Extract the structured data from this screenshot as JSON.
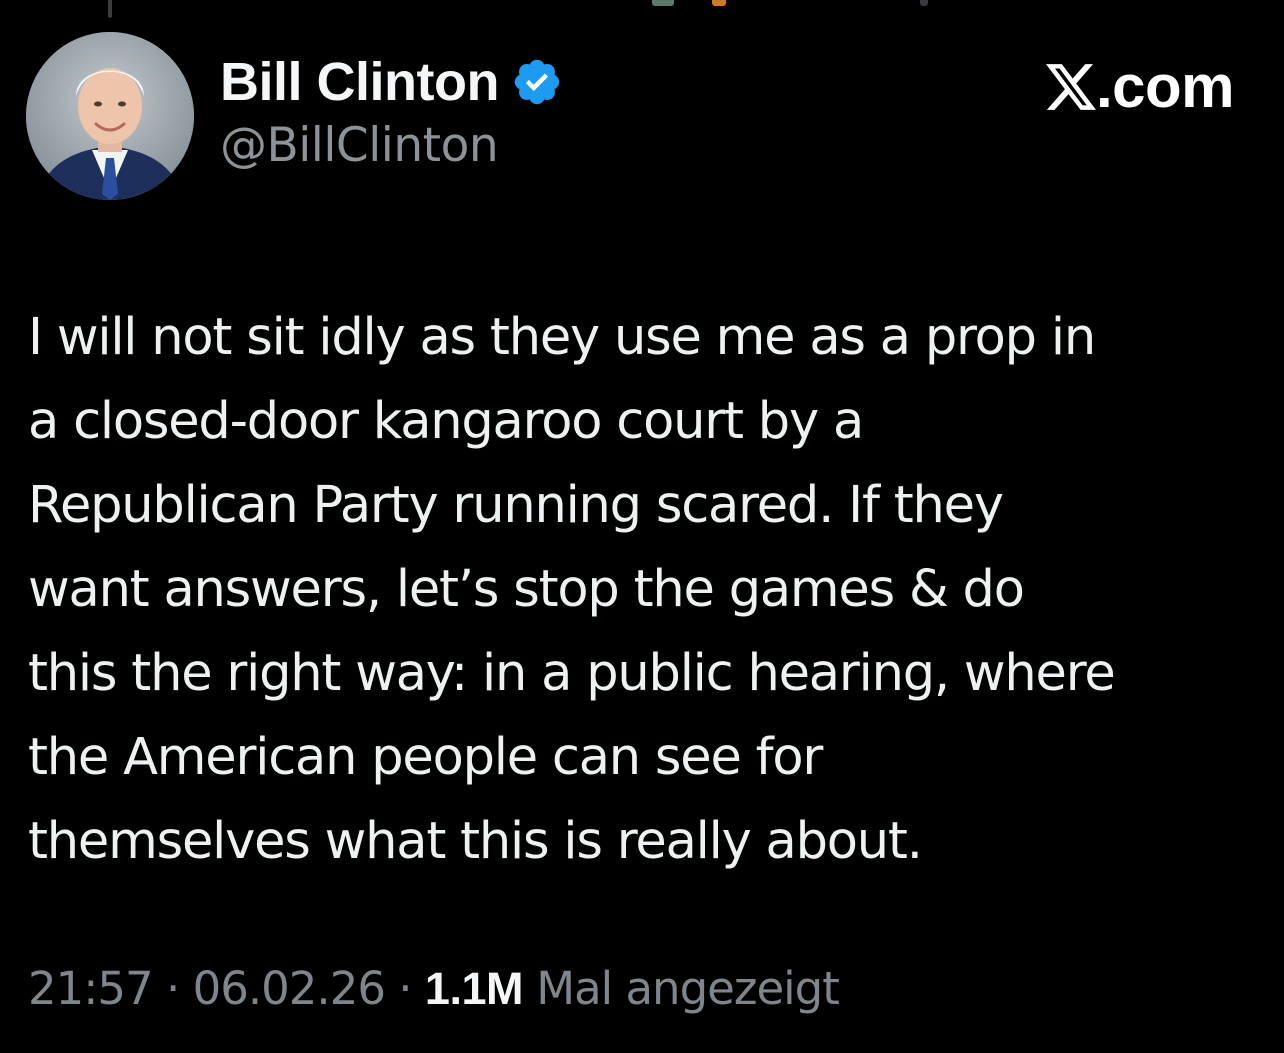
{
  "author": {
    "display_name": "Bill Clinton",
    "handle": "@BillClinton",
    "verified": true,
    "avatar_icon": "avatar-photo-icon"
  },
  "brand": {
    "label": "X.com",
    "logo_letter": "X",
    "suffix": ".com"
  },
  "tweet": {
    "lines": [
      "I will not sit idly as they use me as a prop in",
      "a closed-door kangaroo court by a",
      "Republican Party running scared. If they",
      "want answers, let’s stop the games & do",
      "this the right way: in a public hearing, where",
      "the American people can see for",
      "themselves what this is really about."
    ]
  },
  "meta": {
    "time": "21:57",
    "separator": " · ",
    "date": "06.02.26",
    "views_count": "1.1M",
    "views_label": " Mal angezeigt"
  },
  "colors": {
    "background": "#000000",
    "text_primary": "#eef1f2",
    "text_secondary": "#8b9298",
    "verified_blue": "#1d9bf0"
  }
}
